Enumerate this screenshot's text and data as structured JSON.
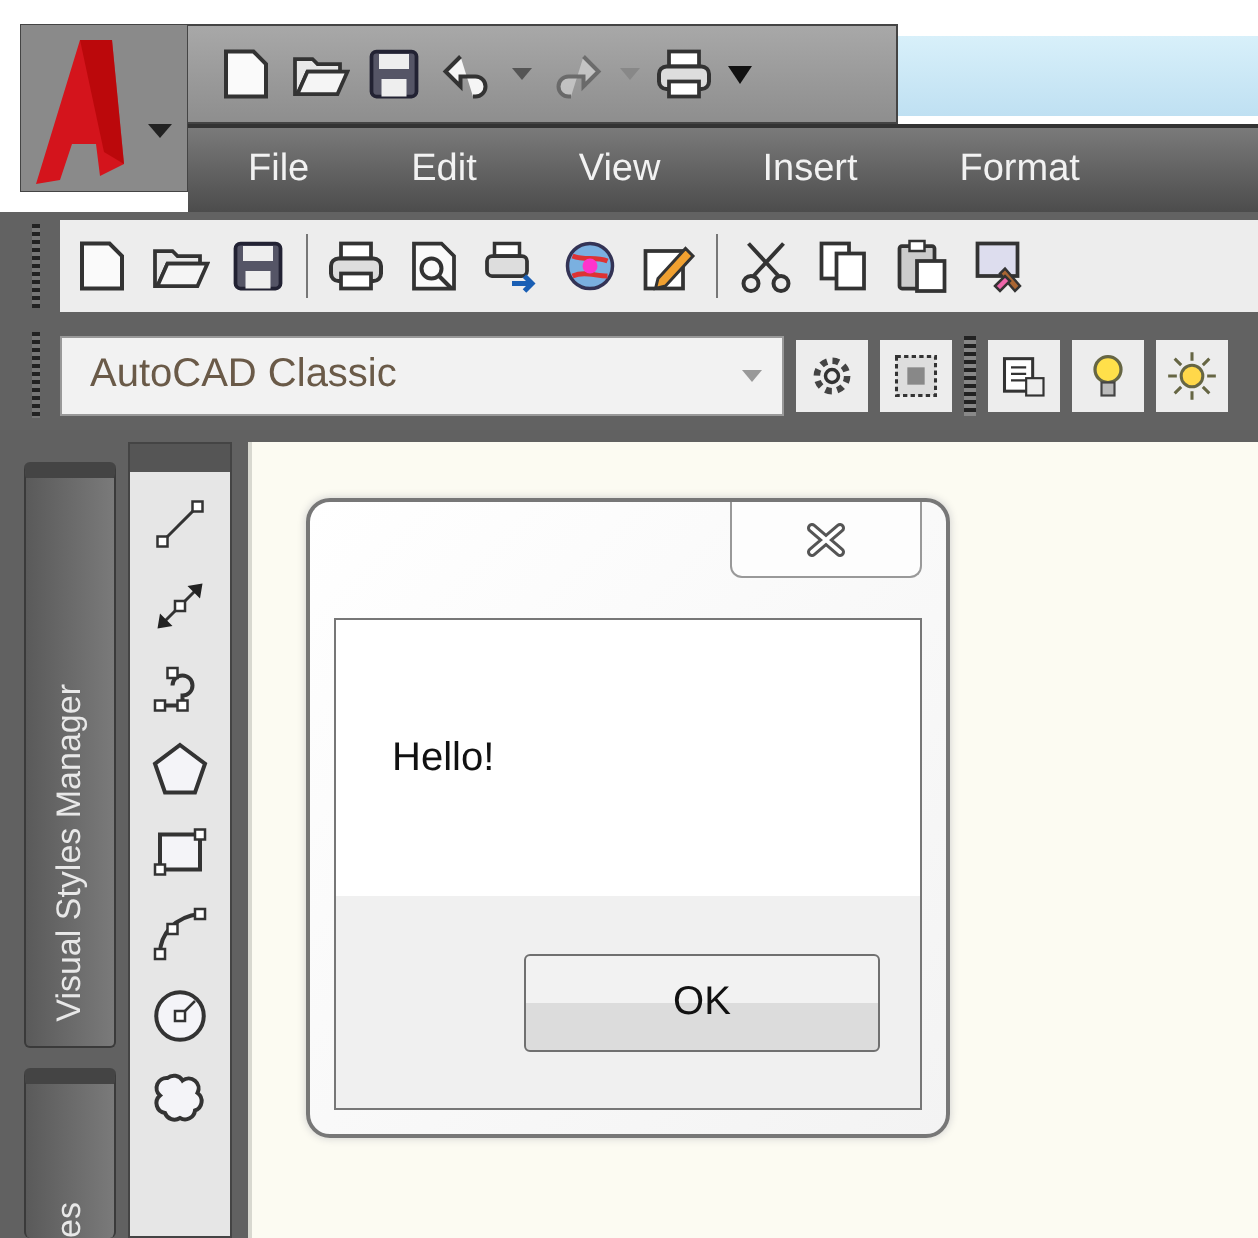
{
  "quick_access": [
    {
      "kind": "new",
      "disabled": false
    },
    {
      "kind": "open",
      "disabled": false
    },
    {
      "kind": "save",
      "disabled": false
    },
    {
      "kind": "undo",
      "disabled": false
    },
    {
      "kind": "redo",
      "disabled": true
    },
    {
      "kind": "print",
      "disabled": false
    }
  ],
  "menu": [
    "File",
    "Edit",
    "View",
    "Insert",
    "Format"
  ],
  "standard_toolbar": [
    {
      "kind": "new"
    },
    {
      "kind": "open"
    },
    {
      "kind": "save"
    },
    {
      "kind": "sep"
    },
    {
      "kind": "print"
    },
    {
      "kind": "preview"
    },
    {
      "kind": "publish"
    },
    {
      "kind": "globe"
    },
    {
      "kind": "edit"
    },
    {
      "kind": "sep"
    },
    {
      "kind": "cut"
    },
    {
      "kind": "copy"
    },
    {
      "kind": "paste"
    },
    {
      "kind": "brush"
    }
  ],
  "workspace": {
    "value": "AutoCAD Classic"
  },
  "workspace_tools": [
    {
      "kind": "gear"
    },
    {
      "kind": "frame"
    },
    {
      "kind": "grip"
    },
    {
      "kind": "layers"
    },
    {
      "kind": "bulb"
    },
    {
      "kind": "sun"
    }
  ],
  "side_tabs": [
    {
      "label": "Visual Styles Manager"
    },
    {
      "label": "es"
    }
  ],
  "draw_toolbar": [
    {
      "kind": "line"
    },
    {
      "kind": "xline"
    },
    {
      "kind": "polyline"
    },
    {
      "kind": "polygon"
    },
    {
      "kind": "rectangle"
    },
    {
      "kind": "arc"
    },
    {
      "kind": "circle"
    },
    {
      "kind": "cloud"
    }
  ],
  "dialog": {
    "message": "Hello!",
    "button": "OK"
  }
}
